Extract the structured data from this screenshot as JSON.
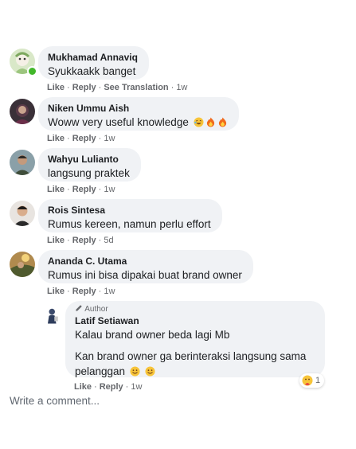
{
  "comments": [
    {
      "author": "Mukhamad Annaviq",
      "text": "Syukkaakk banget",
      "actions": {
        "like": "Like",
        "reply": "Reply",
        "extra": "See Translation",
        "time": "1w"
      }
    },
    {
      "author": "Niken Ummu Aish",
      "text": "Woww very useful knowledge",
      "emoji_icons": [
        "laughing-emoji-icon",
        "fire-emoji-icon",
        "fire-emoji-icon"
      ],
      "actions": {
        "like": "Like",
        "reply": "Reply",
        "time": "1w"
      }
    },
    {
      "author": "Wahyu Lulianto",
      "text": "langsung praktek",
      "actions": {
        "like": "Like",
        "reply": "Reply",
        "time": "1w"
      }
    },
    {
      "author": "Rois Sintesa",
      "text": "Rumus kereen, namun perlu effort",
      "actions": {
        "like": "Like",
        "reply": "Reply",
        "time": "5d"
      }
    },
    {
      "author": "Ananda C. Utama",
      "text": "Rumus ini bisa dipakai buat brand owner",
      "actions": {
        "like": "Like",
        "reply": "Reply",
        "time": "1w"
      }
    }
  ],
  "reply": {
    "badge": "Author",
    "author": "Latif Setiawan",
    "line1": "Kalau brand owner beda lagi Mb",
    "line2": "Kan brand owner ga berinteraksi langsung sama",
    "line3": "pelanggan",
    "emoji_icons": [
      "smile-emoji-icon",
      "smile-emoji-icon"
    ],
    "reaction_count": "1",
    "reaction_icon": "care-reaction-icon",
    "actions": {
      "like": "Like",
      "reply": "Reply",
      "time": "1w"
    }
  },
  "write_comment_placeholder": "Write a comment...",
  "colors": {
    "bubble": "#f0f2f5",
    "online": "#42b72a",
    "muted": "#65676b"
  }
}
